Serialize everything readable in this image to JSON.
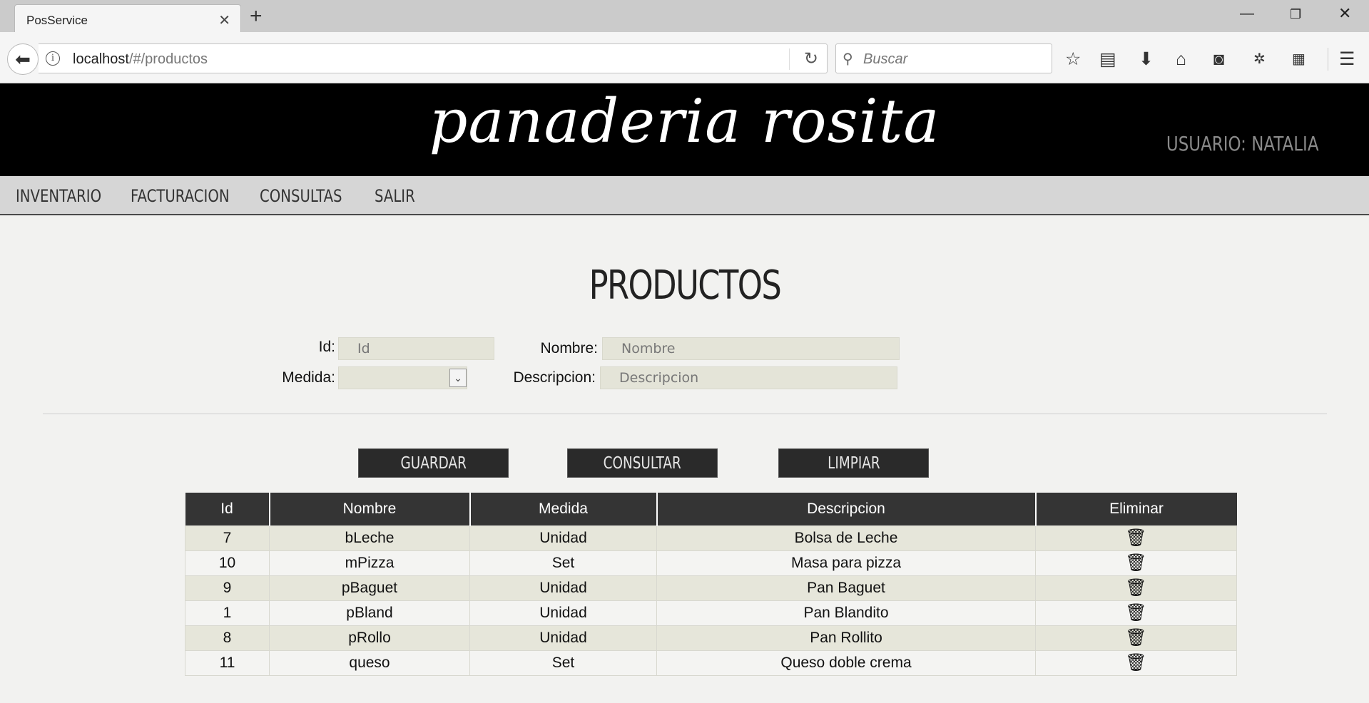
{
  "browser": {
    "tab_title": "PosService",
    "url_host": "localhost",
    "url_path": "/#/productos",
    "search_placeholder": "Buscar"
  },
  "header": {
    "logo": "panaderia rosita",
    "user_label": "USUARIO: NATALIA"
  },
  "menu": {
    "items": [
      "INVENTARIO",
      "FACTURACION",
      "CONSULTAS",
      "SALIR"
    ]
  },
  "page": {
    "title": "PRODUCTOS"
  },
  "form": {
    "id_label": "Id:",
    "id_placeholder": "Id",
    "nombre_label": "Nombre:",
    "nombre_placeholder": "Nombre",
    "medida_label": "Medida:",
    "medida_value": "",
    "descripcion_label": "Descripcion:",
    "descripcion_placeholder": "Descripcion"
  },
  "buttons": {
    "guardar": "GUARDAR",
    "consultar": "CONSULTAR",
    "limpiar": "LIMPIAR"
  },
  "table": {
    "headers": [
      "Id",
      "Nombre",
      "Medida",
      "Descripcion",
      "Eliminar"
    ],
    "rows": [
      {
        "id": "7",
        "nombre": "bLeche",
        "medida": "Unidad",
        "descripcion": "Bolsa de Leche"
      },
      {
        "id": "10",
        "nombre": "mPizza",
        "medida": "Set",
        "descripcion": "Masa para pizza"
      },
      {
        "id": "9",
        "nombre": "pBaguet",
        "medida": "Unidad",
        "descripcion": "Pan Baguet"
      },
      {
        "id": "1",
        "nombre": "pBland",
        "medida": "Unidad",
        "descripcion": "Pan Blandito"
      },
      {
        "id": "8",
        "nombre": "pRollo",
        "medida": "Unidad",
        "descripcion": "Pan Rollito"
      },
      {
        "id": "11",
        "nombre": "queso",
        "medida": "Set",
        "descripcion": "Queso doble crema"
      }
    ]
  },
  "colors": {
    "header_bg": "#000000",
    "menu_bg": "#d6d6d6",
    "table_header_bg": "#343434",
    "row_odd_bg": "#e6e6da",
    "input_bg": "#e4e4d8"
  }
}
